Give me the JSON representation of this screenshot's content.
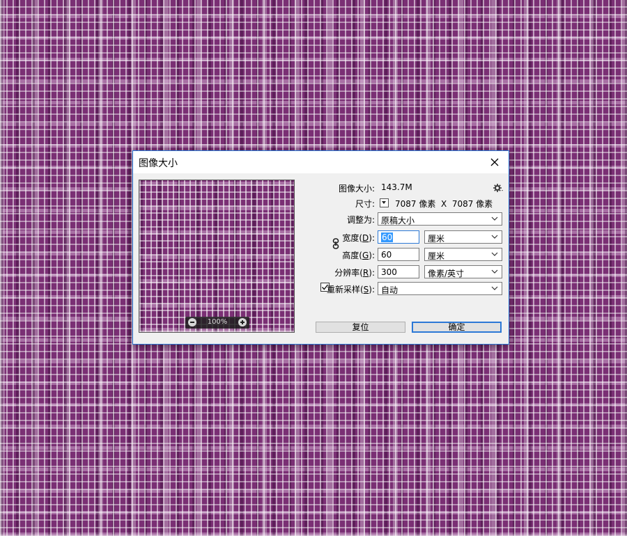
{
  "dialog": {
    "title": "图像大小",
    "image_size_label": "图像大小:",
    "image_size_value": "143.7M",
    "dimensions_label": "尺寸:",
    "dimensions_value": "7087 像素  X  7087 像素",
    "fit_to_label": "调整为:",
    "fit_to_value": "原稿大小",
    "width_label_pre": "宽度(",
    "width_label_key": "D",
    "width_label_post": "):",
    "width_value": "60",
    "width_unit": "厘米",
    "height_label_pre": "高度(",
    "height_label_key": "G",
    "height_label_post": "):",
    "height_value": "60",
    "height_unit": "厘米",
    "resolution_label_pre": "分辨率(",
    "resolution_label_key": "R",
    "resolution_label_post": "):",
    "resolution_value": "300",
    "resolution_unit": "像素/英寸",
    "resample_label_pre": "重新采样(",
    "resample_label_key": "S",
    "resample_label_post": "):",
    "resample_checked": true,
    "resample_value": "自动",
    "reset_button": "复位",
    "ok_button": "确定",
    "zoom_level": "100%"
  },
  "icons": {
    "close": "close-icon",
    "gear": "gear-icon",
    "link": "link-icon",
    "chevron": "chevron-down-icon",
    "zoom_out": "zoom-out-icon",
    "zoom_in": "zoom-in-icon"
  },
  "colors": {
    "accent": "#2b78d6",
    "background_texture": "#7a2f74",
    "dialog_bg": "#f0f0f0"
  }
}
